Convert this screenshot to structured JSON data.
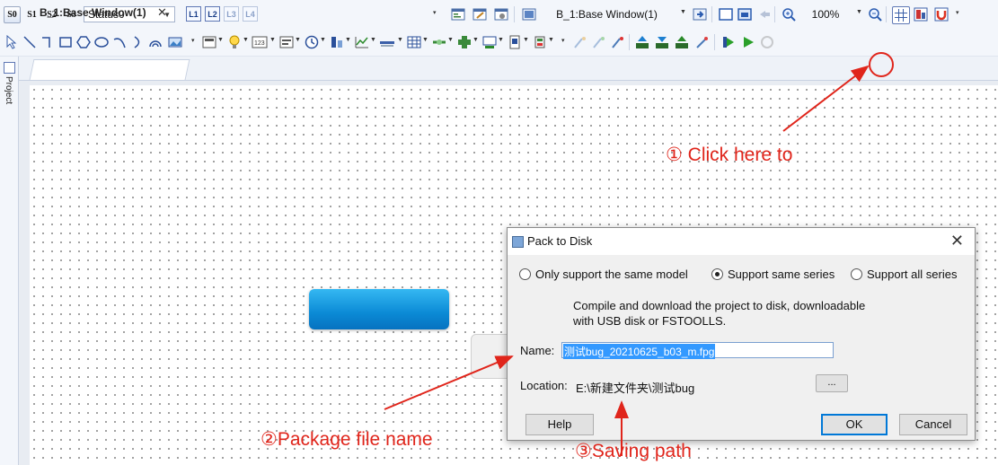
{
  "toolbar1": {
    "state_buttons": [
      "S0",
      "S1",
      "S2",
      "S3"
    ],
    "status_combo": "Status0",
    "layer_buttons": [
      "L1",
      "L2",
      "L3",
      "L4"
    ],
    "window_combo": "B_1:Base Window(1)",
    "zoom_combo": "100%"
  },
  "side_panel": {
    "label": "Project"
  },
  "tabs": [
    {
      "label": "B_1:Base Window(1)",
      "close": "✕"
    }
  ],
  "dialog": {
    "title": "Pack to Disk",
    "close": "✕",
    "radios": [
      {
        "label": "Only support the same model",
        "checked": false
      },
      {
        "label": "Support same series",
        "checked": true
      },
      {
        "label": "Support all series",
        "checked": false
      }
    ],
    "desc_line1": "Compile and download the project to disk, downloadable",
    "desc_line2": "with USB disk or FSTOOLLS.",
    "name_label": "Name:",
    "name_value": "测试bug_20210625_b03_m.fpg",
    "location_label": "Location:",
    "location_value": "E:\\新建文件夹\\测试bug",
    "browse": "...",
    "help": "Help",
    "ok": "OK",
    "cancel": "Cancel"
  },
  "annotations": {
    "a1": "① Click    here    to",
    "a2": "②Package file name",
    "a3": "③Saving path"
  },
  "colors": {
    "annotation": "#e0251b",
    "accent": "#0078d7"
  }
}
